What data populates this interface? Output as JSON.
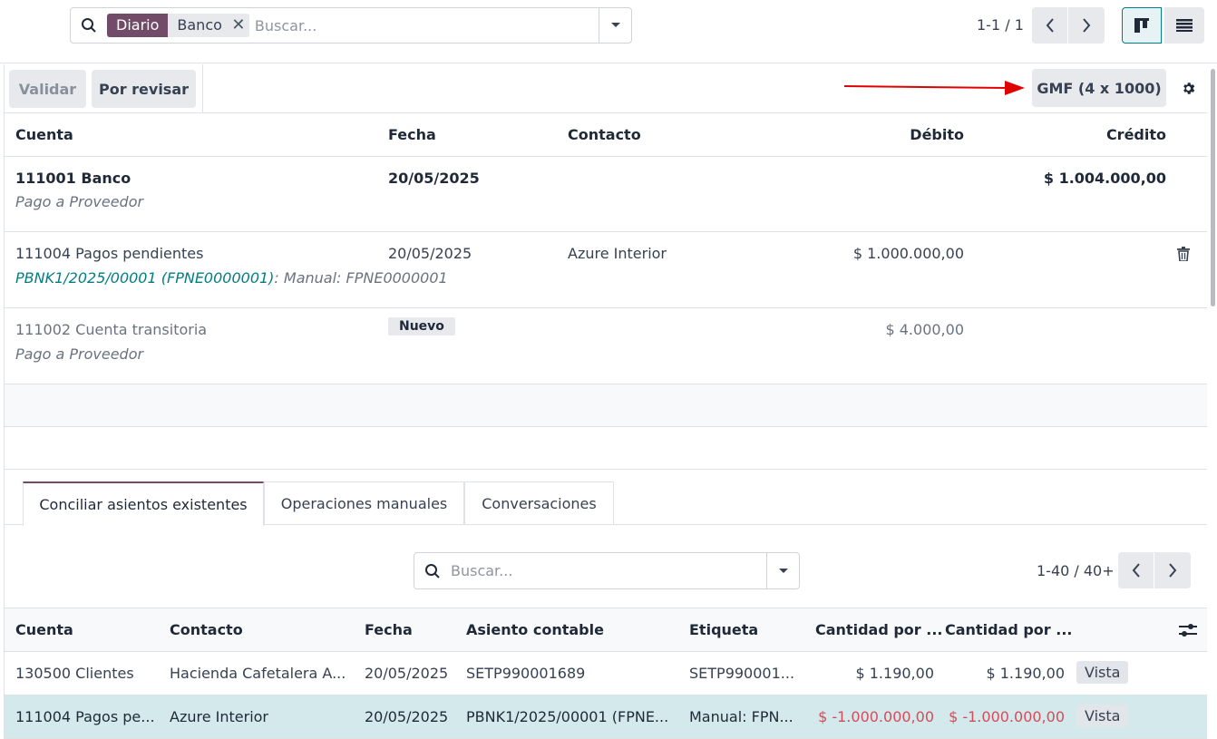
{
  "search": {
    "facet_type": "Diario",
    "facet_value": "Banco",
    "placeholder": "Buscar..."
  },
  "pager": {
    "value": "1-1 / 1"
  },
  "toolbar": {
    "validate_label": "Validar",
    "review_label": "Por revisar",
    "gmf_label": "GMF (4 x 1000)"
  },
  "lines_table": {
    "headers": [
      "Cuenta",
      "Fecha",
      "Contacto",
      "Débito",
      "Crédito"
    ],
    "rows": [
      {
        "account": "111001 Banco",
        "label": "Pago a Proveedor",
        "date": "20/05/2025",
        "contact": "",
        "debit": "",
        "credit": "$ 1.004.000,00"
      },
      {
        "account": "111004 Pagos pendientes",
        "ref": "PBNK1/2025/00001 (FPNE0000001)",
        "ref_suffix": ": Manual: FPNE0000001",
        "date": "20/05/2025",
        "contact": "Azure Interior",
        "debit": "$ 1.000.000,00",
        "credit": ""
      },
      {
        "account": "111002 Cuenta transitoria",
        "label": "Pago a Proveedor",
        "badge": "Nuevo",
        "date": "",
        "contact": "",
        "debit": "$ 4.000,00",
        "credit": ""
      }
    ]
  },
  "tabs": [
    {
      "label": "Conciliar asientos existentes",
      "active": true
    },
    {
      "label": "Operaciones manuales",
      "active": false
    },
    {
      "label": "Conversaciones",
      "active": false
    }
  ],
  "search2": {
    "placeholder": "Buscar..."
  },
  "pager2": {
    "value": "1-40 / 40+"
  },
  "entries_table": {
    "headers": [
      "Cuenta",
      "Contacto",
      "Fecha",
      "Asiento contable",
      "Etiqueta",
      "Cantidad por ...",
      "Cantidad por ..."
    ],
    "rows": [
      {
        "account": "130500 Clientes",
        "contact": "Hacienda Cafetalera A...",
        "date": "20/05/2025",
        "move": "SETP990001689",
        "label": "SETP990001...",
        "amount1": "$ 1.190,00",
        "amount2": "$ 1.190,00",
        "action": "Vista"
      },
      {
        "account": "111004 Pagos pe...",
        "contact": "Azure Interior",
        "date": "20/05/2025",
        "move": "PBNK1/2025/00001 (FPNE...",
        "label": "Manual: FPN...",
        "amount1": "$ -1.000.000,00",
        "amount2": "$ -1.000.000,00",
        "action": "Vista"
      }
    ]
  },
  "colors": {
    "brand": "#714b67",
    "accent": "#017e84",
    "negative": "#d44c59",
    "annotation_arrow": "#e00000"
  }
}
